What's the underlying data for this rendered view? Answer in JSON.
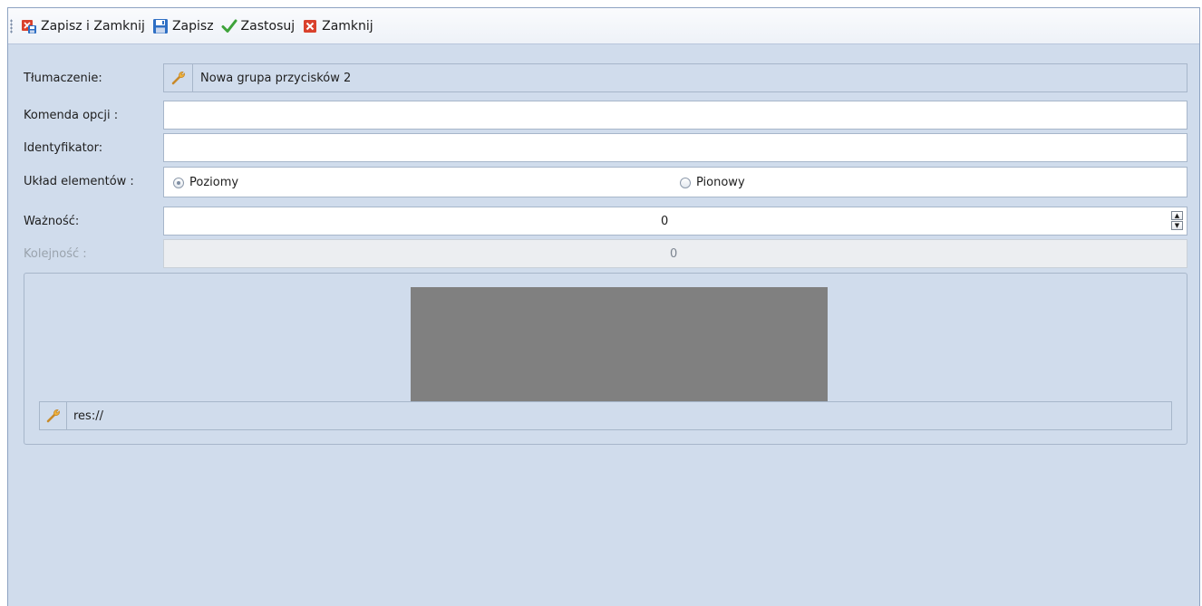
{
  "toolbar": {
    "save_close": "Zapisz i Zamknij",
    "save": "Zapisz",
    "apply": "Zastosuj",
    "close": "Zamknij"
  },
  "form": {
    "translation_label": "Tłumaczenie:",
    "translation_value": "Nowa grupa przycisków 2",
    "option_command_label": "Komenda opcji :",
    "option_command_value": "",
    "identifier_label": "Identyfikator:",
    "identifier_value": "",
    "layout_label": "Układ elementów :",
    "layout_options": [
      "Poziomy",
      "Pionowy"
    ],
    "layout_selected": "Poziomy",
    "importance_label": "Ważność:",
    "importance_value": "0",
    "order_label": "Kolejność :",
    "order_value": "0"
  },
  "image_group": {
    "resource_path": "res://"
  },
  "colors": {
    "window_bg": "#d0dcec",
    "preview_fill": "#808080",
    "accent_red": "#d9412c",
    "accent_blue": "#2e6fc4",
    "accent_green": "#3ea33a"
  }
}
